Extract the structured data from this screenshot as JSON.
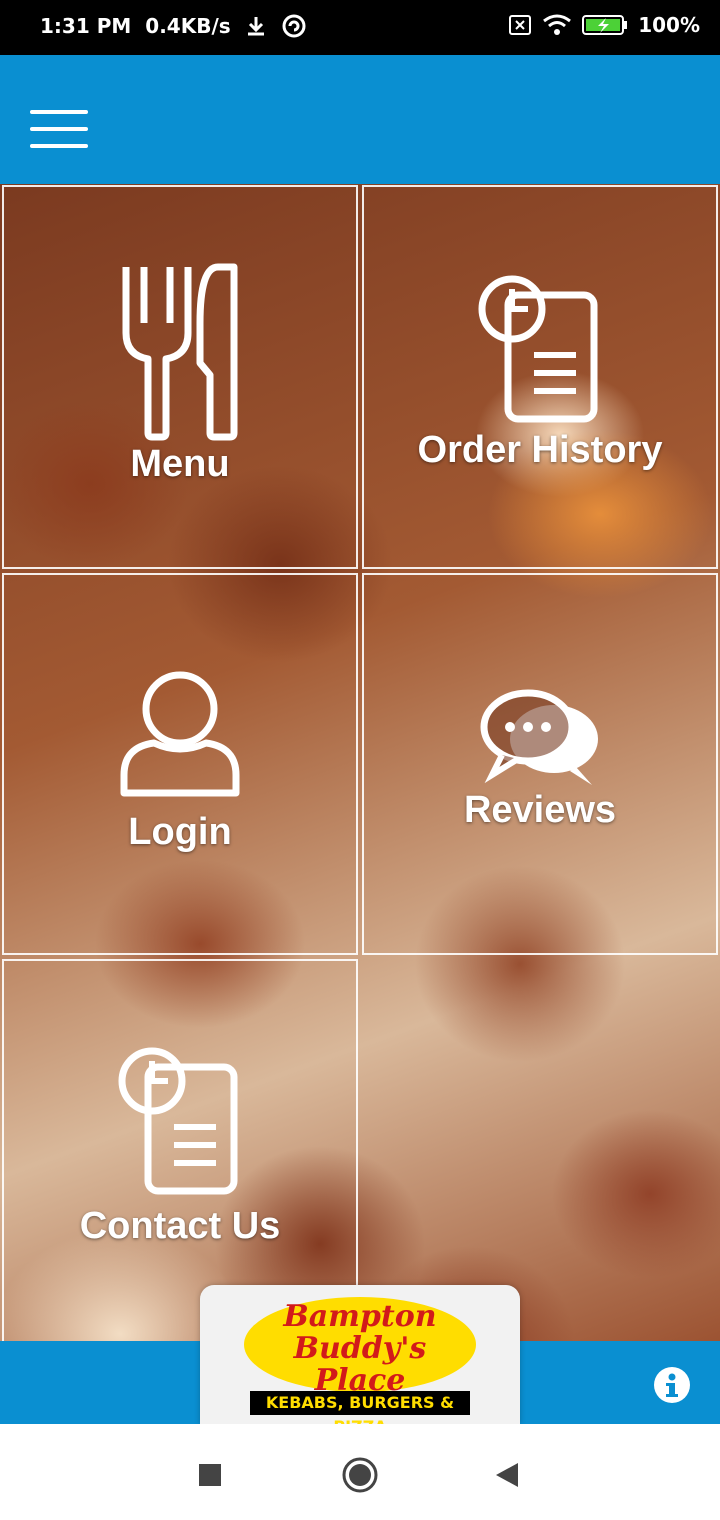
{
  "status_bar": {
    "time": "1:31 PM",
    "speed": "0.4KB/s",
    "battery": "100%"
  },
  "app_bar": {
    "menu_icon": "hamburger-icon"
  },
  "tiles": [
    {
      "label": "Menu",
      "icon": "fork-knife-icon"
    },
    {
      "label": "Order History",
      "icon": "clock-document-icon"
    },
    {
      "label": "Login",
      "icon": "user-icon"
    },
    {
      "label": "Reviews",
      "icon": "chat-bubbles-icon"
    },
    {
      "label": "Contact Us",
      "icon": "clock-document-icon"
    }
  ],
  "logo": {
    "line1": "Bampton",
    "line2": "Buddy's Place",
    "tagline": "KEBABS, BURGERS & PIZZA"
  },
  "colors": {
    "brand_blue": "#0a8fd1",
    "logo_yellow": "#ffdd00",
    "logo_red": "#d21a1a"
  },
  "nav": {
    "recents": "square-icon",
    "home": "circle-icon",
    "back": "triangle-back-icon"
  }
}
